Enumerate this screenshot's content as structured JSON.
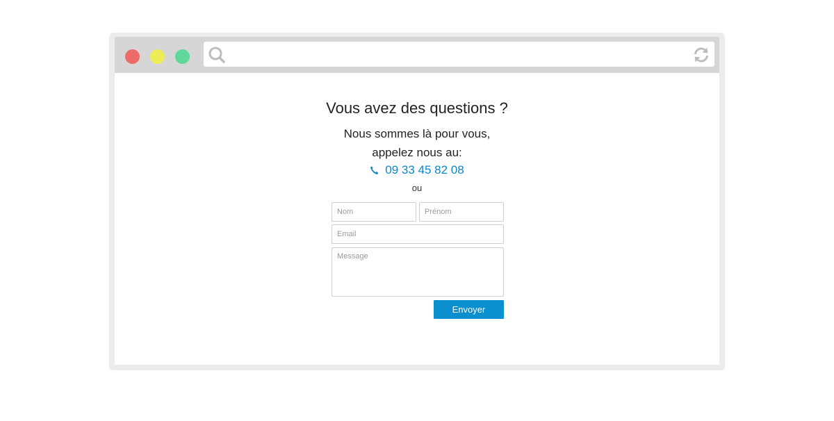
{
  "browser": {
    "traffic_lights": [
      "close-dot",
      "minimize-dot",
      "maximize-dot"
    ],
    "address_bar": {
      "value": "",
      "search_icon": "search-icon",
      "refresh_icon": "refresh-icon"
    }
  },
  "colors": {
    "accent": "#0b8fcf",
    "phone": "#0b86c8",
    "close": "#ee6b6b",
    "minimize": "#eded58",
    "maximize": "#5fd89a"
  },
  "contact": {
    "title": "Vous avez des questions ?",
    "line1": "Nous sommes là pour vous,",
    "line2": "appelez nous au:",
    "phone_icon": "phone-icon",
    "phone": "09 33 45 82 08",
    "or": "ou"
  },
  "form": {
    "nom_placeholder": "Nom",
    "prenom_placeholder": "Prénom",
    "email_placeholder": "Email",
    "message_placeholder": "Message",
    "submit_label": "Envoyer"
  }
}
